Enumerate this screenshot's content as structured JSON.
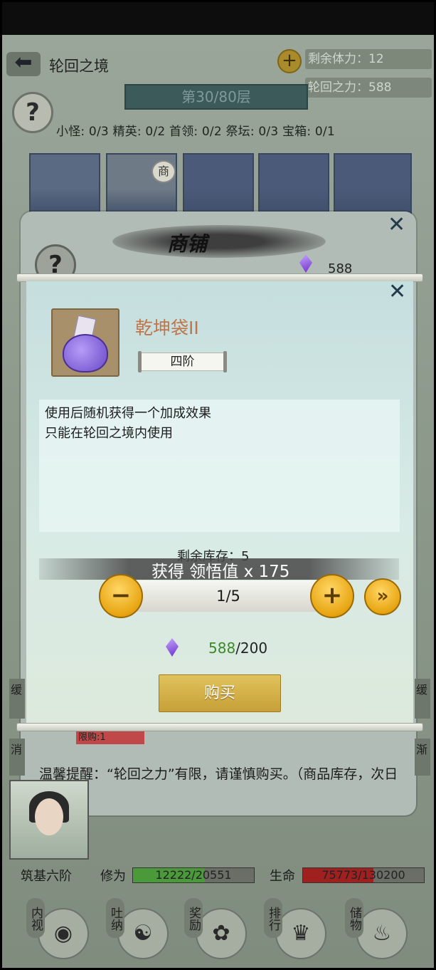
{
  "header": {
    "back_icon": "back-arrow-icon",
    "title": "轮回之境",
    "stamina": "剩余体力：12",
    "reincarnation_power": "轮回之力：588"
  },
  "floor": {
    "label": "第30/80层",
    "stats": "小怪: 0/3 精英: 0/2 首领: 0/2 祭坛: 0/3 宝箱: 0/1"
  },
  "cards": {
    "shop_tag": "商"
  },
  "shop": {
    "title": "商铺",
    "currency_amount": "588"
  },
  "item": {
    "name": "乾坤袋II",
    "rank": "四阶",
    "description": [
      "使用后随机获得一个加成效果",
      "只能在轮回之境内使用"
    ],
    "stock": "剩余库存：5",
    "gain": "获得 领悟值 x 175",
    "quantity": "1/5",
    "price_owned": "588",
    "price_total": "/200",
    "buy_label": "购买"
  },
  "behind": {
    "limit_label": "限购:1",
    "left_char_1": "缓",
    "left_char_2": "消",
    "right_char_1": "缓",
    "right_char_2": "渐"
  },
  "tip": "温馨提醒：“轮回之力”有限，请谨慎购买。（商品库存，次日补货。）",
  "player": {
    "realm": "筑基六阶",
    "cultivation_label": "修为",
    "cultivation_value": "12222/20551",
    "cultivation_progress": 0.595,
    "life_label": "生命",
    "life_value": "75773/130200",
    "life_progress": 0.582
  },
  "nav": [
    {
      "label": "内视",
      "icon": "eye-icon"
    },
    {
      "label": "吐纳",
      "icon": "meditate-icon"
    },
    {
      "label": "奖励",
      "icon": "gift-icon"
    },
    {
      "label": "排行",
      "icon": "ranking-icon"
    },
    {
      "label": "储物",
      "icon": "storage-bag-icon"
    }
  ],
  "colors": {
    "item_name": "#c0764a",
    "price_owned": "#3a8a2a",
    "button_gold": "#e8a512",
    "cultivation_bar": "#4a9a3a",
    "life_bar": "#a02020"
  }
}
